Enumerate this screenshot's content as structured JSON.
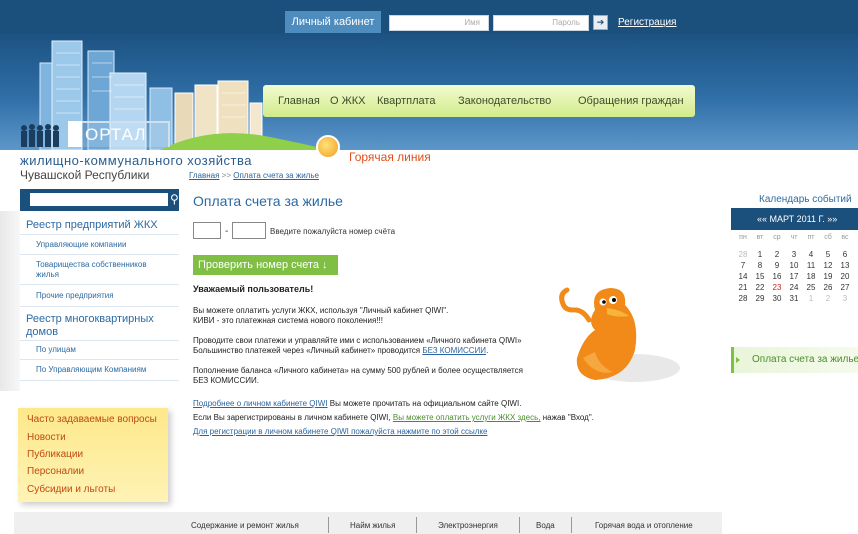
{
  "topbar": {
    "cabinet_label": "Личный кабинет",
    "login_placeholder": "Имя",
    "password_placeholder": "Пароль",
    "go_icon": "arrow-right-icon",
    "register_link": "Регистрация"
  },
  "nav": {
    "items": [
      "Главная",
      "О ЖКХ",
      "Квартплата",
      "Законодательство",
      "Обращения граждан"
    ]
  },
  "logo": {
    "text": "ОРТАЛ",
    "line1": "жилищно-коммунального хозяйства",
    "line2": "Чувашской Республики"
  },
  "hotline": {
    "label": "Горячая линия"
  },
  "breadcrumb": {
    "home": "Главная",
    "sep": " >> ",
    "current": "Оплата счета за жилье"
  },
  "sidebar": {
    "search_icon": "search-icon",
    "sections": [
      {
        "title": "Реестр предприятий ЖКХ",
        "items": [
          "Управляющие компании",
          "Товарищества собственников жилья",
          "Прочие предприятия"
        ]
      },
      {
        "title": "Реестр многоквартирных домов",
        "items": [
          "По улицам",
          "По Управляющим Компаниям"
        ]
      }
    ],
    "yellow_links": [
      "Часто задаваемые вопросы",
      "Новости",
      "Публикации",
      "Персоналии",
      "Субсидии и льготы"
    ]
  },
  "main": {
    "title": "Оплата счета за жилье",
    "account_hint": "Введите пожалуйста номер счёта",
    "account_dash": "-",
    "check_button": "Проверить номер счета ↓",
    "greeting": "Уважаемый пользователь!",
    "p1_line1": "Вы можете оплатить услуги ЖКХ, используя \"Личный кабинет QIWI\".",
    "p1_line2": "КИВИ - это платежная система нового поколения!!!",
    "p2_line1": "Проводите свои платежи и управляйте ими с использованием «Личного кабинета QIWI»",
    "p2_line2_a": "Большинство платежей через «Личный кабинет» проводится ",
    "p2_line2_link": "БЕЗ КОМИССИИ",
    "p2_line2_b": ".",
    "p3_line1": "Пополнение баланса «Личного кабинета» на сумму 500 рублей и более осуществляется",
    "p3_line2": "БЕЗ КОМИССИИ.",
    "p4_link": "Подробнее о личном кабинете QIWI",
    "p4_rest": " Вы можете прочитать на официальном сайте QIWI.",
    "p5_a": "Если Вы зарегистрированы в личном кабинете QIWI, ",
    "p5_link": "Вы можете оплатить услуги ЖКХ здесь,",
    "p5_b": " нажав \"Вход\".",
    "p6_link": "Для регистрации в личном кабинете QIWI пожалуйста нажмите по этой ссылке"
  },
  "calendar": {
    "title": "Календарь событий",
    "month_label": "«« МАРТ 2011 Г. »»",
    "weekdays": [
      "пн",
      "вт",
      "ср",
      "чт",
      "пт",
      "сб",
      "вс"
    ],
    "weeks": [
      [
        "28",
        "1",
        "2",
        "3",
        "4",
        "5",
        "6"
      ],
      [
        "7",
        "8",
        "9",
        "10",
        "11",
        "12",
        "13"
      ],
      [
        "14",
        "15",
        "16",
        "17",
        "18",
        "19",
        "20"
      ],
      [
        "21",
        "22",
        "23",
        "24",
        "25",
        "26",
        "27"
      ],
      [
        "28",
        "29",
        "30",
        "31",
        "1",
        "2",
        "3"
      ]
    ],
    "highlight_day": "23",
    "highlight_color": "#d02020"
  },
  "right_link": "Оплата счета за жилье",
  "footer": {
    "items": [
      "Содержание и ремонт жилья",
      "Найм жилья",
      "Электроэнергия",
      "Вода",
      "Горячая вода и отопление"
    ]
  },
  "colors": {
    "dark_blue": "#1b4f7c",
    "link_blue": "#2c6aa3",
    "green": "#7fbf43",
    "orange": "#e0501a"
  }
}
